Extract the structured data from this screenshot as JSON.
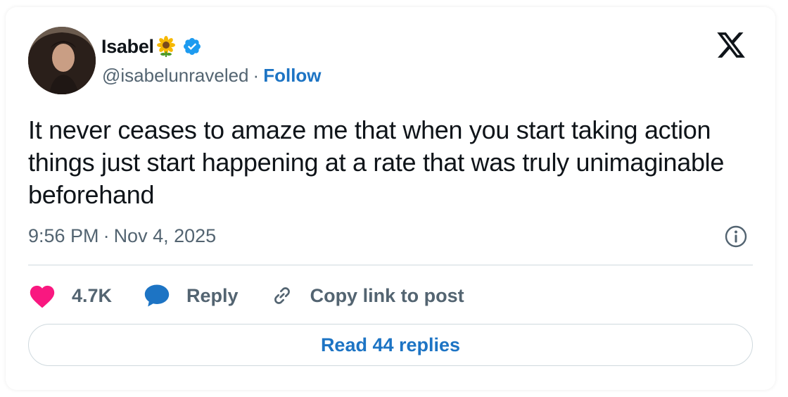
{
  "author": {
    "name": "Isabel",
    "handle": "@isabelunraveled",
    "separator": "·",
    "follow_label": "Follow",
    "emoji": "sunflower",
    "verified": true
  },
  "post": {
    "text": "It never ceases to amaze me that when you start taking action things just start happening at a rate that was truly unimaginable beforehand",
    "time": "9:56 PM",
    "separator": "·",
    "date": "Nov 4, 2025"
  },
  "actions": {
    "likes": "4.7K",
    "reply_label": "Reply",
    "copy_label": "Copy link to post"
  },
  "read_replies_label": "Read 44 replies",
  "icons": {
    "logo": "x-logo-icon",
    "info": "info-icon",
    "like": "heart-icon",
    "reply": "speech-bubble-icon",
    "copy": "link-icon"
  },
  "colors": {
    "text": "#0f1419",
    "secondary": "#536471",
    "link": "#1d74c4",
    "heart": "#f91880",
    "verified": "#1d9bf0",
    "border": "#cfd9de"
  }
}
